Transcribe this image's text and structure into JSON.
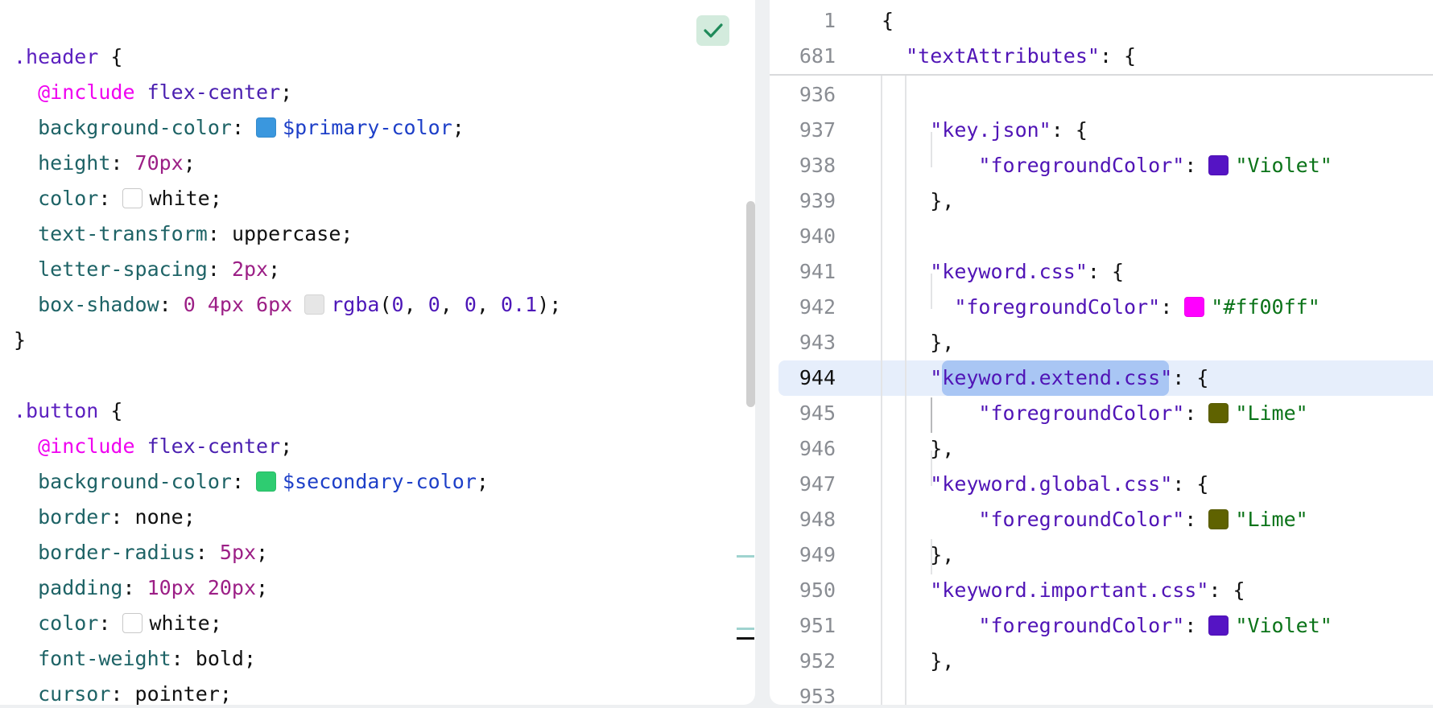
{
  "left_editor": {
    "status": "no-problems-check-icon",
    "lines": [
      [
        [
          ".header",
          "sel"
        ],
        [
          " {",
          "punc"
        ]
      ],
      [
        [
          "  ",
          "plain"
        ],
        [
          "@include",
          "at"
        ],
        [
          " flex-center",
          "mix"
        ],
        [
          ";",
          "punc"
        ]
      ],
      [
        [
          "  background-color",
          "prop"
        ],
        [
          ": ",
          "punc"
        ],
        [
          "#3a97de",
          "swatch"
        ],
        [
          "$primary-color",
          "var"
        ],
        [
          ";",
          "punc"
        ]
      ],
      [
        [
          "  height",
          "prop"
        ],
        [
          ": ",
          "punc"
        ],
        [
          "70px",
          "num"
        ],
        [
          ";",
          "punc"
        ]
      ],
      [
        [
          "  color",
          "prop"
        ],
        [
          ": ",
          "punc"
        ],
        [
          "#ffffff",
          "swatch"
        ],
        [
          "white",
          "plain"
        ],
        [
          ";",
          "punc"
        ]
      ],
      [
        [
          "  text-transform",
          "prop"
        ],
        [
          ": ",
          "punc"
        ],
        [
          "uppercase",
          "plain"
        ],
        [
          ";",
          "punc"
        ]
      ],
      [
        [
          "  letter-spacing",
          "prop"
        ],
        [
          ": ",
          "punc"
        ],
        [
          "2px",
          "num"
        ],
        [
          ";",
          "punc"
        ]
      ],
      [
        [
          "  box-shadow",
          "prop"
        ],
        [
          ": ",
          "punc"
        ],
        [
          "0 4px 6px ",
          "num"
        ],
        [
          "#e6e6e6",
          "swatch"
        ],
        [
          "rgba",
          "fn"
        ],
        [
          "(",
          "punc"
        ],
        [
          "0",
          "fn"
        ],
        [
          ", ",
          "punc"
        ],
        [
          "0",
          "fn"
        ],
        [
          ", ",
          "punc"
        ],
        [
          "0",
          "fn"
        ],
        [
          ", ",
          "punc"
        ],
        [
          "0.1",
          "fn"
        ],
        [
          ");",
          "punc"
        ]
      ],
      [
        [
          "}",
          "punc"
        ]
      ],
      [],
      [
        [
          ".button",
          "sel"
        ],
        [
          " {",
          "punc"
        ]
      ],
      [
        [
          "  ",
          "plain"
        ],
        [
          "@include",
          "at"
        ],
        [
          " flex-center",
          "mix"
        ],
        [
          ";",
          "punc"
        ]
      ],
      [
        [
          "  background-color",
          "prop"
        ],
        [
          ": ",
          "punc"
        ],
        [
          "#2ecc71",
          "swatch"
        ],
        [
          "$secondary-color",
          "var"
        ],
        [
          ";",
          "punc"
        ]
      ],
      [
        [
          "  border",
          "prop"
        ],
        [
          ": ",
          "punc"
        ],
        [
          "none",
          "plain"
        ],
        [
          ";",
          "punc"
        ]
      ],
      [
        [
          "  border-radius",
          "prop"
        ],
        [
          ": ",
          "punc"
        ],
        [
          "5px",
          "num"
        ],
        [
          ";",
          "punc"
        ]
      ],
      [
        [
          "  padding",
          "prop"
        ],
        [
          ": ",
          "punc"
        ],
        [
          "10px 20px",
          "num"
        ],
        [
          ";",
          "punc"
        ]
      ],
      [
        [
          "  color",
          "prop"
        ],
        [
          ": ",
          "punc"
        ],
        [
          "#ffffff",
          "swatch"
        ],
        [
          "white",
          "plain"
        ],
        [
          ";",
          "punc"
        ]
      ],
      [
        [
          "  font-weight",
          "prop"
        ],
        [
          ": ",
          "punc"
        ],
        [
          "bold",
          "plain"
        ],
        [
          ";",
          "punc"
        ]
      ],
      [
        [
          "  cursor",
          "prop"
        ],
        [
          ": ",
          "punc"
        ],
        [
          "pointer",
          "plain"
        ],
        [
          ";",
          "punc"
        ]
      ]
    ]
  },
  "right_editor": {
    "sticky": [
      {
        "num": "1",
        "tokens": [
          [
            "{",
            "punc"
          ]
        ]
      },
      {
        "num": "681",
        "tokens": [
          [
            "  ",
            "plain"
          ],
          [
            "\"textAttributes\"",
            "key"
          ],
          [
            ": {",
            "punc"
          ]
        ]
      }
    ],
    "current_line": "944",
    "selected_text": "keyword.extend.css",
    "lines": [
      {
        "num": "936",
        "tokens": []
      },
      {
        "num": "937",
        "tokens": [
          [
            "    ",
            "plain"
          ],
          [
            "\"key.json\"",
            "key"
          ],
          [
            ": {",
            "punc"
          ]
        ]
      },
      {
        "num": "938",
        "tokens": [
          [
            "        ",
            "plain"
          ],
          [
            "\"foregroundColor\"",
            "key"
          ],
          [
            ": ",
            "punc"
          ],
          [
            "#5514c4",
            "swatch"
          ],
          [
            "\"Violet\"",
            "str"
          ]
        ]
      },
      {
        "num": "939",
        "tokens": [
          [
            "    },",
            "punc"
          ]
        ]
      },
      {
        "num": "940",
        "tokens": []
      },
      {
        "num": "941",
        "tokens": [
          [
            "    ",
            "plain"
          ],
          [
            "\"keyword.css\"",
            "key"
          ],
          [
            ": {",
            "punc"
          ]
        ]
      },
      {
        "num": "942",
        "tokens": [
          [
            "      ",
            "plain"
          ],
          [
            "\"foregroundColor\"",
            "key"
          ],
          [
            ": ",
            "punc"
          ],
          [
            "#ff00ff",
            "swatch"
          ],
          [
            "\"#ff00ff\"",
            "str"
          ]
        ]
      },
      {
        "num": "943",
        "tokens": [
          [
            "    },",
            "punc"
          ]
        ]
      },
      {
        "num": "944",
        "tokens": [
          [
            "    \"",
            "key"
          ],
          [
            "keyword.extend.css",
            "key"
          ],
          [
            "\"",
            "key"
          ],
          [
            ": {",
            "punc"
          ]
        ]
      },
      {
        "num": "945",
        "tokens": [
          [
            "        ",
            "plain"
          ],
          [
            "\"foregroundColor\"",
            "key"
          ],
          [
            ": ",
            "punc"
          ],
          [
            "#5f6200",
            "swatch"
          ],
          [
            "\"Lime\"",
            "str"
          ]
        ]
      },
      {
        "num": "946",
        "tokens": [
          [
            "    },",
            "punc"
          ]
        ]
      },
      {
        "num": "947",
        "tokens": [
          [
            "    ",
            "plain"
          ],
          [
            "\"keyword.global.css\"",
            "key"
          ],
          [
            ": {",
            "punc"
          ]
        ]
      },
      {
        "num": "948",
        "tokens": [
          [
            "        ",
            "plain"
          ],
          [
            "\"foregroundColor\"",
            "key"
          ],
          [
            ": ",
            "punc"
          ],
          [
            "#5f6200",
            "swatch"
          ],
          [
            "\"Lime\"",
            "str"
          ]
        ]
      },
      {
        "num": "949",
        "tokens": [
          [
            "    },",
            "punc"
          ]
        ]
      },
      {
        "num": "950",
        "tokens": [
          [
            "    ",
            "plain"
          ],
          [
            "\"keyword.important.css\"",
            "key"
          ],
          [
            ": {",
            "punc"
          ]
        ]
      },
      {
        "num": "951",
        "tokens": [
          [
            "        ",
            "plain"
          ],
          [
            "\"foregroundColor\"",
            "key"
          ],
          [
            ": ",
            "punc"
          ],
          [
            "#5514c4",
            "swatch"
          ],
          [
            "\"Violet\"",
            "str"
          ]
        ]
      },
      {
        "num": "952",
        "tokens": [
          [
            "    },",
            "punc"
          ]
        ]
      },
      {
        "num": "953",
        "tokens": []
      }
    ]
  },
  "colors": {
    "check_bg": "#d3ebdd",
    "check": "#1f8a5a",
    "current_line": "#e6eefb",
    "selection": "#a9c6f4",
    "marker_change": "#9fd3cf"
  }
}
